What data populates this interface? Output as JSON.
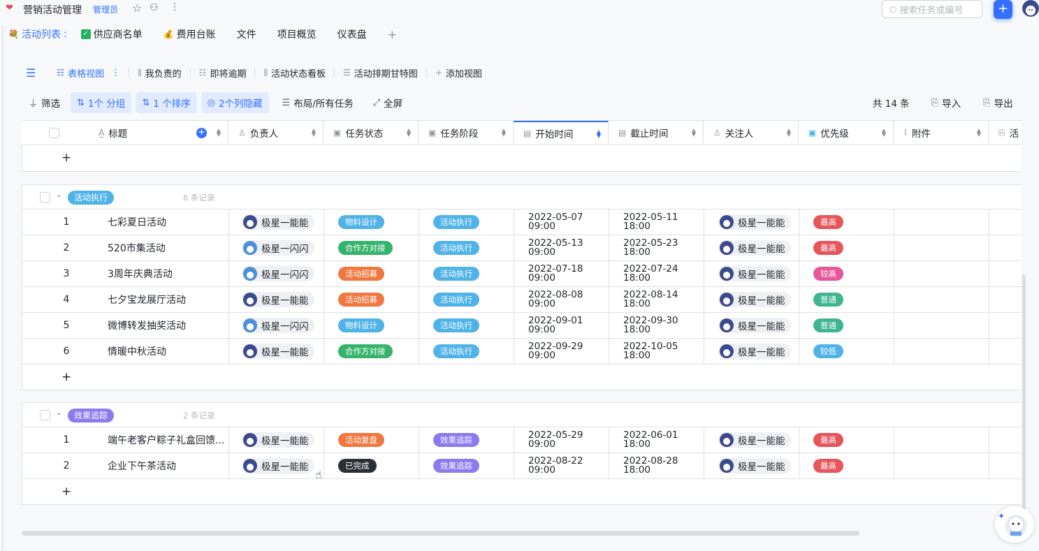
{
  "app": {
    "icon": "heart-icon",
    "title": "营销活动管理",
    "role": "管理员"
  },
  "search": {
    "placeholder": "搜索任务或编号"
  },
  "tabs": [
    {
      "label": "活动列表",
      "icon": "bouquet-icon",
      "active": true
    },
    {
      "label": "供应商名单",
      "icon": "check-icon"
    },
    {
      "label": "费用台账",
      "icon": "moneybag-icon"
    },
    {
      "label": "文件"
    },
    {
      "label": "项目概览"
    },
    {
      "label": "仪表盘"
    }
  ],
  "views": [
    "表格视图",
    "我负责的",
    "即将逾期",
    "活动状态看板",
    "活动排期甘特图",
    "添加视图"
  ],
  "toolbar": {
    "filter": "筛选",
    "group": "1个 分组",
    "sort": "1 个排序",
    "hidden": "2个列隐藏",
    "layout": "布局/所有任务",
    "fullscreen": "全屏",
    "total": "共 14 条",
    "import": "导入",
    "export": "导出"
  },
  "columns": [
    "标题",
    "负责人",
    "任务状态",
    "任务阶段",
    "开始时间",
    "截止时间",
    "关注人",
    "优先级",
    "附件",
    "活"
  ],
  "groups": [
    {
      "label": "活动执行",
      "color": "#4fb3e8",
      "count": "6 条记录",
      "rows": [
        {
          "idx": "1",
          "title": "七彩夏日活动",
          "owner": "极星一能能",
          "owner_alt": false,
          "status": "物料设计",
          "status_color": "#4fb3e8",
          "stage": "活动执行",
          "stage_color": "#4fb3e8",
          "start": [
            "2022-05-07",
            "09:00"
          ],
          "end": [
            "2022-05-11",
            "18:00"
          ],
          "watcher": "极星一能能",
          "priority": "最高",
          "priority_color": "#e5555b"
        },
        {
          "idx": "2",
          "title": "520市集活动",
          "owner": "极星一闪闪",
          "owner_alt": true,
          "status": "合作方对接",
          "status_color": "#34b36a",
          "stage": "活动执行",
          "stage_color": "#4fb3e8",
          "start": [
            "2022-05-13",
            "09:00"
          ],
          "end": [
            "2022-05-23",
            "18:00"
          ],
          "watcher": "极星一能能",
          "priority": "最高",
          "priority_color": "#e5555b"
        },
        {
          "idx": "3",
          "title": "3周年庆典活动",
          "owner": "极星一闪闪",
          "owner_alt": true,
          "status": "活动招募",
          "status_color": "#f0773f",
          "stage": "活动执行",
          "stage_color": "#4fb3e8",
          "start": [
            "2022-07-18",
            "09:00"
          ],
          "end": [
            "2022-07-24",
            "18:00"
          ],
          "watcher": "极星一能能",
          "priority": "较高",
          "priority_color": "#e8559a"
        },
        {
          "idx": "4",
          "title": "七夕宝龙展厅活动",
          "owner": "极星一能能",
          "owner_alt": false,
          "status": "活动招募",
          "status_color": "#f0773f",
          "stage": "活动执行",
          "stage_color": "#4fb3e8",
          "start": [
            "2022-08-08",
            "09:00"
          ],
          "end": [
            "2022-08-14",
            "18:00"
          ],
          "watcher": "极星一能能",
          "priority": "普通",
          "priority_color": "#3fb58f"
        },
        {
          "idx": "5",
          "title": "微博转发抽奖活动",
          "owner": "极星一闪闪",
          "owner_alt": true,
          "status": "物料设计",
          "status_color": "#4fb3e8",
          "stage": "活动执行",
          "stage_color": "#4fb3e8",
          "start": [
            "2022-09-01",
            "09:00"
          ],
          "end": [
            "2022-09-30",
            "18:00"
          ],
          "watcher": "极星一能能",
          "priority": "普通",
          "priority_color": "#3fb58f"
        },
        {
          "idx": "6",
          "title": "情暖中秋活动",
          "owner": "极星一能能",
          "owner_alt": false,
          "status": "合作方对接",
          "status_color": "#34b36a",
          "stage": "活动执行",
          "stage_color": "#4fb3e8",
          "start": [
            "2022-09-29",
            "09:00"
          ],
          "end": [
            "2022-10-05",
            "18:00"
          ],
          "watcher": "极星一能能",
          "priority": "较低",
          "priority_color": "#4fb3e8"
        }
      ]
    },
    {
      "label": "效果追踪",
      "color": "#8c7bef",
      "count": "2 条记录",
      "rows": [
        {
          "idx": "1",
          "title": "端午老客户粽子礼盒回馈...",
          "owner": "极星一能能",
          "owner_alt": false,
          "status": "活动复盘",
          "status_color": "#f0773f",
          "stage": "效果追踪",
          "stage_color": "#8c7bef",
          "start": [
            "2022-05-29",
            "09:00"
          ],
          "end": [
            "2022-06-01",
            "18:00"
          ],
          "watcher": "极星一能能",
          "priority": "最高",
          "priority_color": "#e5555b"
        },
        {
          "idx": "2",
          "title": "企业下午茶活动",
          "owner": "极星一能能",
          "owner_alt": false,
          "status": "已完成",
          "status_color": "#2b2f36",
          "stage": "效果追踪",
          "stage_color": "#8c7bef",
          "start": [
            "2022-08-22",
            "09:00"
          ],
          "end": [
            "2022-08-28",
            "18:00"
          ],
          "watcher": "极星一能能",
          "priority": "最高",
          "priority_color": "#e5555b"
        }
      ]
    }
  ]
}
